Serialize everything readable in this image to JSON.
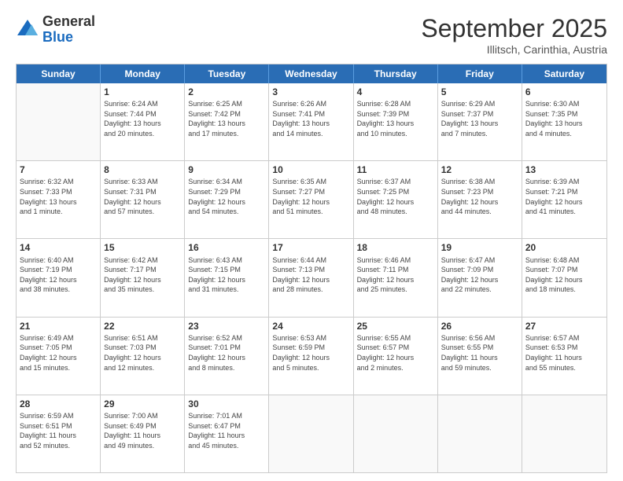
{
  "logo": {
    "general": "General",
    "blue": "Blue"
  },
  "header": {
    "month": "September 2025",
    "location": "Illitsch, Carinthia, Austria"
  },
  "weekdays": [
    "Sunday",
    "Monday",
    "Tuesday",
    "Wednesday",
    "Thursday",
    "Friday",
    "Saturday"
  ],
  "weeks": [
    [
      {
        "day": "",
        "info": ""
      },
      {
        "day": "1",
        "info": "Sunrise: 6:24 AM\nSunset: 7:44 PM\nDaylight: 13 hours\nand 20 minutes."
      },
      {
        "day": "2",
        "info": "Sunrise: 6:25 AM\nSunset: 7:42 PM\nDaylight: 13 hours\nand 17 minutes."
      },
      {
        "day": "3",
        "info": "Sunrise: 6:26 AM\nSunset: 7:41 PM\nDaylight: 13 hours\nand 14 minutes."
      },
      {
        "day": "4",
        "info": "Sunrise: 6:28 AM\nSunset: 7:39 PM\nDaylight: 13 hours\nand 10 minutes."
      },
      {
        "day": "5",
        "info": "Sunrise: 6:29 AM\nSunset: 7:37 PM\nDaylight: 13 hours\nand 7 minutes."
      },
      {
        "day": "6",
        "info": "Sunrise: 6:30 AM\nSunset: 7:35 PM\nDaylight: 13 hours\nand 4 minutes."
      }
    ],
    [
      {
        "day": "7",
        "info": "Sunrise: 6:32 AM\nSunset: 7:33 PM\nDaylight: 13 hours\nand 1 minute."
      },
      {
        "day": "8",
        "info": "Sunrise: 6:33 AM\nSunset: 7:31 PM\nDaylight: 12 hours\nand 57 minutes."
      },
      {
        "day": "9",
        "info": "Sunrise: 6:34 AM\nSunset: 7:29 PM\nDaylight: 12 hours\nand 54 minutes."
      },
      {
        "day": "10",
        "info": "Sunrise: 6:35 AM\nSunset: 7:27 PM\nDaylight: 12 hours\nand 51 minutes."
      },
      {
        "day": "11",
        "info": "Sunrise: 6:37 AM\nSunset: 7:25 PM\nDaylight: 12 hours\nand 48 minutes."
      },
      {
        "day": "12",
        "info": "Sunrise: 6:38 AM\nSunset: 7:23 PM\nDaylight: 12 hours\nand 44 minutes."
      },
      {
        "day": "13",
        "info": "Sunrise: 6:39 AM\nSunset: 7:21 PM\nDaylight: 12 hours\nand 41 minutes."
      }
    ],
    [
      {
        "day": "14",
        "info": "Sunrise: 6:40 AM\nSunset: 7:19 PM\nDaylight: 12 hours\nand 38 minutes."
      },
      {
        "day": "15",
        "info": "Sunrise: 6:42 AM\nSunset: 7:17 PM\nDaylight: 12 hours\nand 35 minutes."
      },
      {
        "day": "16",
        "info": "Sunrise: 6:43 AM\nSunset: 7:15 PM\nDaylight: 12 hours\nand 31 minutes."
      },
      {
        "day": "17",
        "info": "Sunrise: 6:44 AM\nSunset: 7:13 PM\nDaylight: 12 hours\nand 28 minutes."
      },
      {
        "day": "18",
        "info": "Sunrise: 6:46 AM\nSunset: 7:11 PM\nDaylight: 12 hours\nand 25 minutes."
      },
      {
        "day": "19",
        "info": "Sunrise: 6:47 AM\nSunset: 7:09 PM\nDaylight: 12 hours\nand 22 minutes."
      },
      {
        "day": "20",
        "info": "Sunrise: 6:48 AM\nSunset: 7:07 PM\nDaylight: 12 hours\nand 18 minutes."
      }
    ],
    [
      {
        "day": "21",
        "info": "Sunrise: 6:49 AM\nSunset: 7:05 PM\nDaylight: 12 hours\nand 15 minutes."
      },
      {
        "day": "22",
        "info": "Sunrise: 6:51 AM\nSunset: 7:03 PM\nDaylight: 12 hours\nand 12 minutes."
      },
      {
        "day": "23",
        "info": "Sunrise: 6:52 AM\nSunset: 7:01 PM\nDaylight: 12 hours\nand 8 minutes."
      },
      {
        "day": "24",
        "info": "Sunrise: 6:53 AM\nSunset: 6:59 PM\nDaylight: 12 hours\nand 5 minutes."
      },
      {
        "day": "25",
        "info": "Sunrise: 6:55 AM\nSunset: 6:57 PM\nDaylight: 12 hours\nand 2 minutes."
      },
      {
        "day": "26",
        "info": "Sunrise: 6:56 AM\nSunset: 6:55 PM\nDaylight: 11 hours\nand 59 minutes."
      },
      {
        "day": "27",
        "info": "Sunrise: 6:57 AM\nSunset: 6:53 PM\nDaylight: 11 hours\nand 55 minutes."
      }
    ],
    [
      {
        "day": "28",
        "info": "Sunrise: 6:59 AM\nSunset: 6:51 PM\nDaylight: 11 hours\nand 52 minutes."
      },
      {
        "day": "29",
        "info": "Sunrise: 7:00 AM\nSunset: 6:49 PM\nDaylight: 11 hours\nand 49 minutes."
      },
      {
        "day": "30",
        "info": "Sunrise: 7:01 AM\nSunset: 6:47 PM\nDaylight: 11 hours\nand 45 minutes."
      },
      {
        "day": "",
        "info": ""
      },
      {
        "day": "",
        "info": ""
      },
      {
        "day": "",
        "info": ""
      },
      {
        "day": "",
        "info": ""
      }
    ]
  ]
}
